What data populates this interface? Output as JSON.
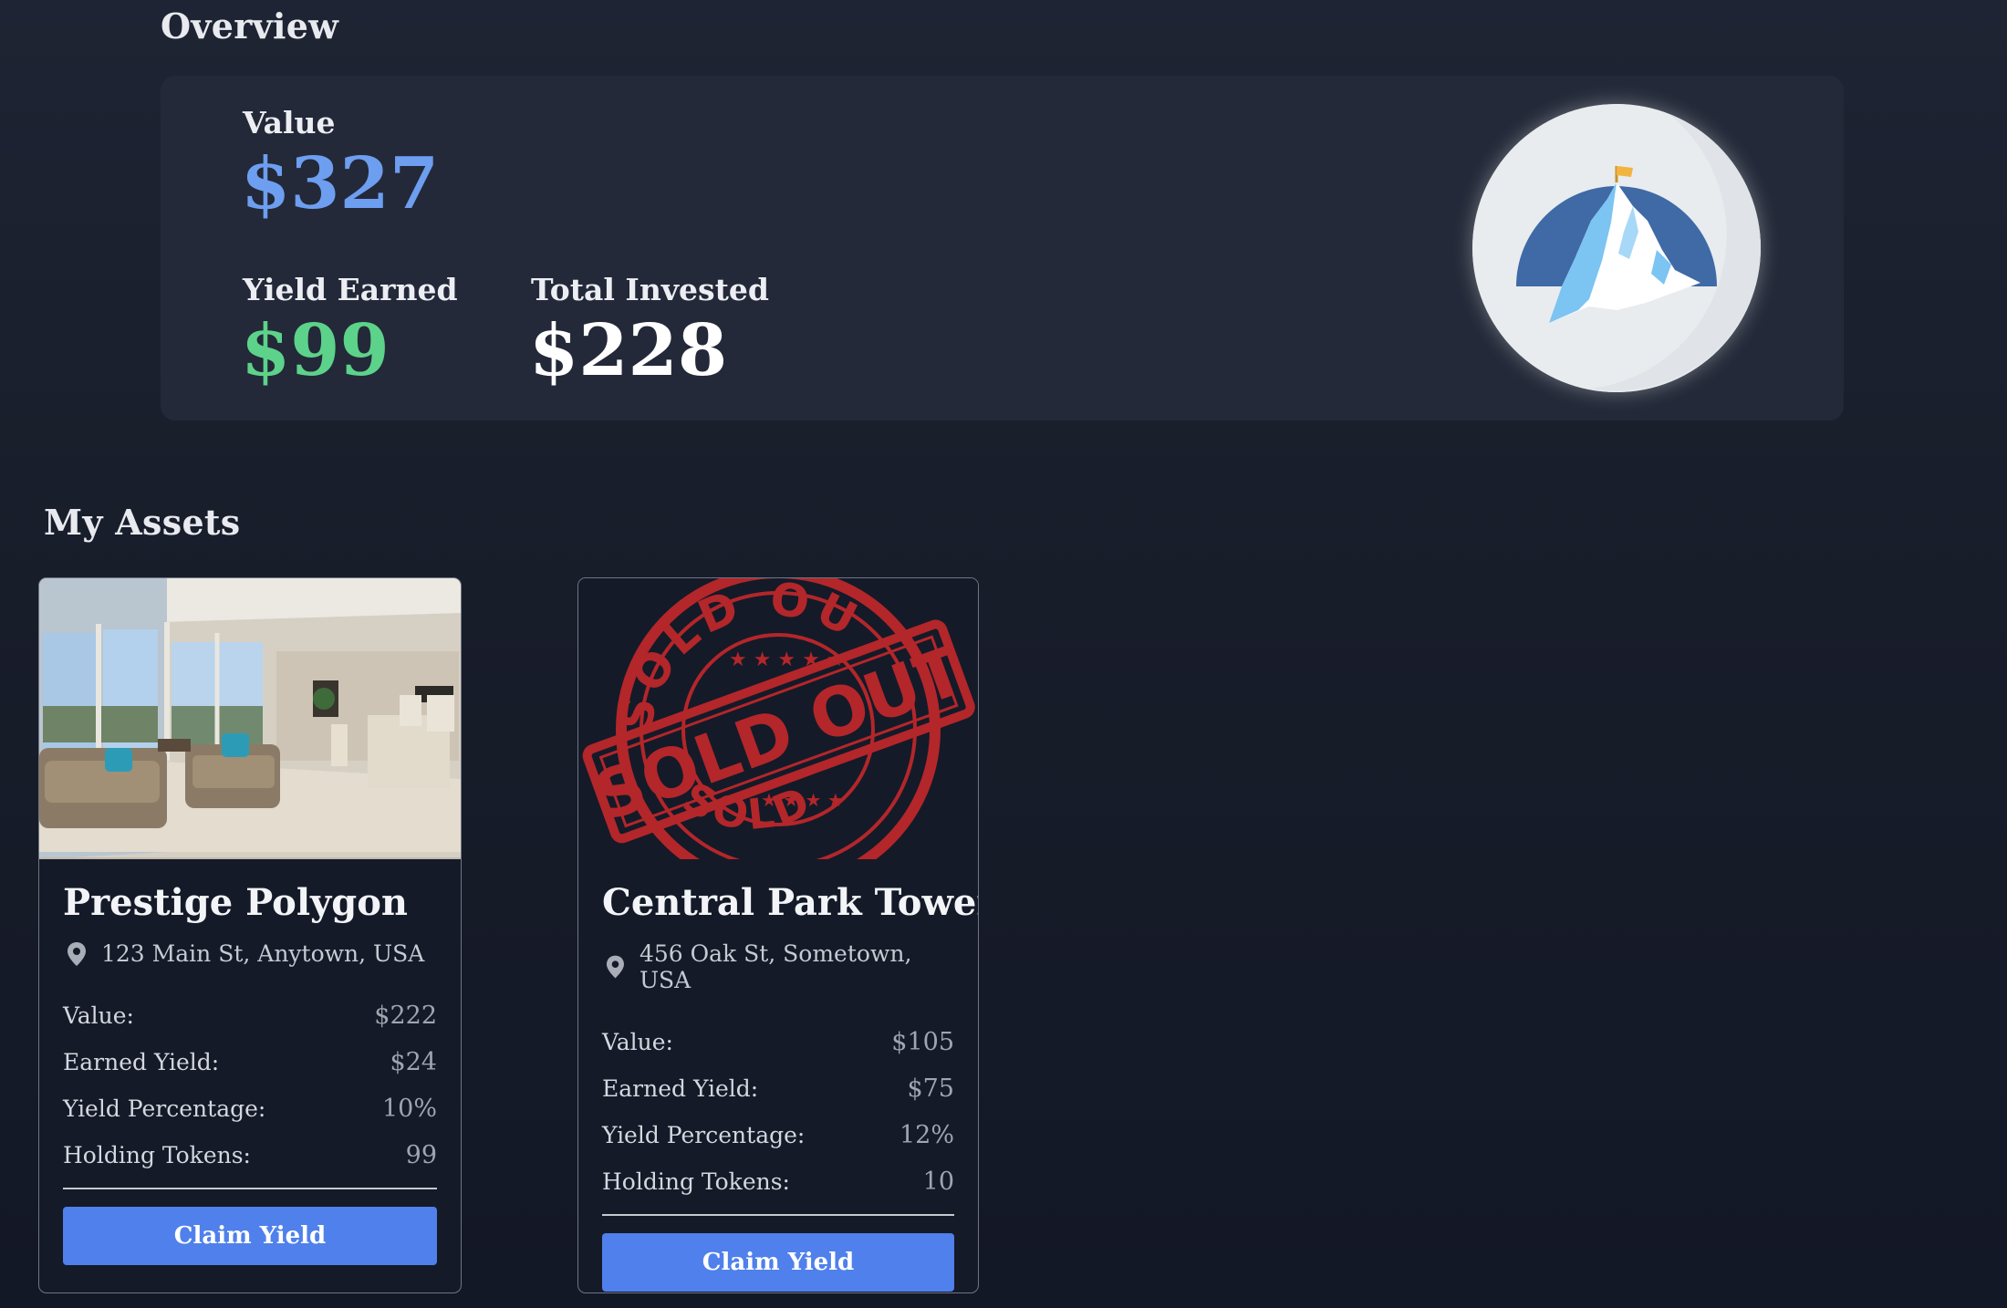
{
  "overview": {
    "title": "Overview",
    "value_label": "Value",
    "value_amount": "$327",
    "yield_label": "Yield Earned",
    "yield_amount": "$99",
    "invested_label": "Total Invested",
    "invested_amount": "$228",
    "colors": {
      "value": "#6d9ef0",
      "yield": "#5dd28a",
      "invested": "#ffffff"
    },
    "logo_icon": "mountain-peak-flag-icon"
  },
  "assets": {
    "title": "My Assets",
    "items": [
      {
        "name": "Prestige Polygon",
        "address": "123 Main St, Anytown, USA",
        "image_icon": "living-room-photo",
        "rows": [
          {
            "label": "Value:",
            "value": "$222"
          },
          {
            "label": "Earned Yield:",
            "value": "$24"
          },
          {
            "label": "Yield Percentage:",
            "value": "10%"
          },
          {
            "label": "Holding Tokens:",
            "value": "99"
          }
        ],
        "button": "Claim Yield"
      },
      {
        "name": "Central Park Tower",
        "address": "456 Oak St, Sometown, USA",
        "image_icon": "sold-out-stamp",
        "stamp": {
          "top": "SOLD OUT",
          "center": "SOLD OUT",
          "bottom": "SOLD OUT"
        },
        "rows": [
          {
            "label": "Value:",
            "value": "$105"
          },
          {
            "label": "Earned Yield:",
            "value": "$75"
          },
          {
            "label": "Yield Percentage:",
            "value": "12%"
          },
          {
            "label": "Holding Tokens:",
            "value": "10"
          }
        ],
        "button": "Claim Yield"
      }
    ]
  },
  "colors": {
    "accent": "#4f80eb",
    "stamp_red": "#b3262a",
    "background": "#181d2a"
  }
}
